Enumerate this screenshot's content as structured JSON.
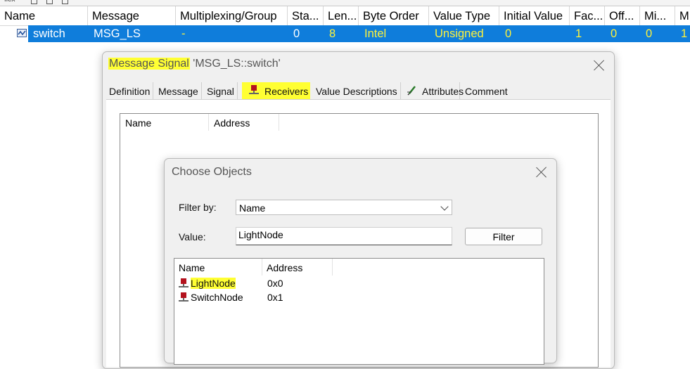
{
  "toolbar": {
    "label": "flex"
  },
  "signal_table": {
    "columns": [
      "Name",
      "Message",
      "Multiplexing/Group",
      "Sta...",
      "Len...",
      "Byte Order",
      "Value Type",
      "Initial Value",
      "Fac...",
      "Off...",
      "Mi...",
      "M"
    ],
    "rows": [
      {
        "icon": "signal-icon",
        "name": "switch",
        "message": "MSG_LS",
        "multiplexing": "-",
        "start": "0",
        "length": "8",
        "byte_order": "Intel",
        "value_type": "Unsigned",
        "initial_value": "0",
        "factor": "1",
        "offset": "0",
        "min": "0",
        "max": "1",
        "selected": true
      }
    ]
  },
  "signal_dialog": {
    "title_highlight": "Message Signal",
    "title_rest": " 'MSG_LS::switch'",
    "tabs": [
      {
        "label": "Definition"
      },
      {
        "label": "Message"
      },
      {
        "label": "Signal"
      },
      {
        "label": "Receivers",
        "icon": "node-icon",
        "active": true
      },
      {
        "label": "Value Descriptions"
      },
      {
        "label": "Attributes",
        "icon": "pencil-icon"
      },
      {
        "label": "Comment"
      }
    ],
    "receivers_list": {
      "columns": [
        "Name",
        "Address"
      ]
    }
  },
  "choose_dialog": {
    "title": "Choose Objects",
    "filter_by_label": "Filter by:",
    "filter_by_value": "Name",
    "value_label": "Value:",
    "value_input": "LightNode",
    "filter_button": "Filter",
    "list_columns": [
      "Name",
      "Address"
    ],
    "objects": [
      {
        "name_highlight": "LightNode",
        "name_rest": "",
        "address": "0x0"
      },
      {
        "name_highlight": "",
        "name_rest": "SwitchNode",
        "address": "0x1"
      }
    ]
  },
  "colors": {
    "selection": "#0f7ddb",
    "highlight": "#ffff33",
    "value_text": "#fff23a",
    "node_icon": "#b4121e"
  }
}
